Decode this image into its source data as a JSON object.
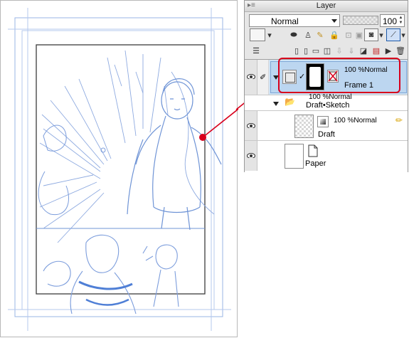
{
  "panel": {
    "title": "Layer",
    "blend_mode": "Normal",
    "opacity_value": "100",
    "opacity_fraction": 1.0
  },
  "layers": {
    "frame": {
      "opacity_mode": "100 %Normal",
      "name": "Frame 1"
    },
    "folder": {
      "opacity_mode": "100 %Normal",
      "name": "Draft•Sketch"
    },
    "draft": {
      "opacity_mode": "100 %Normal",
      "name": "Draft"
    },
    "paper": {
      "name": "Paper"
    }
  },
  "colors": {
    "highlight": "#d8001c",
    "sketch": "#6f94d6",
    "selected_row": "#cfe3f5"
  }
}
